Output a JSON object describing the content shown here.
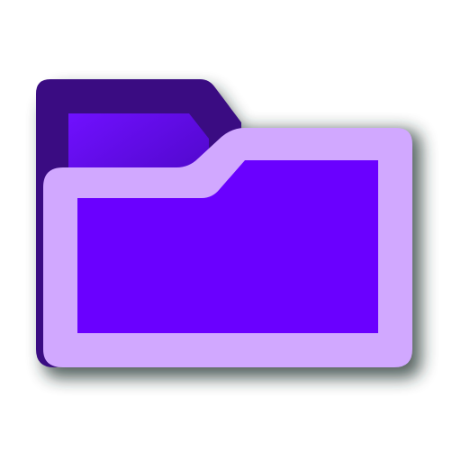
{
  "icon": {
    "name": "folder-icon",
    "colors": {
      "back_panel": "#3a0c82",
      "back_inner": "#6a00ff",
      "front_frame": "#d1a8ff",
      "front_inner": "#6a00ff",
      "shadow": "#1f2d2a"
    }
  }
}
